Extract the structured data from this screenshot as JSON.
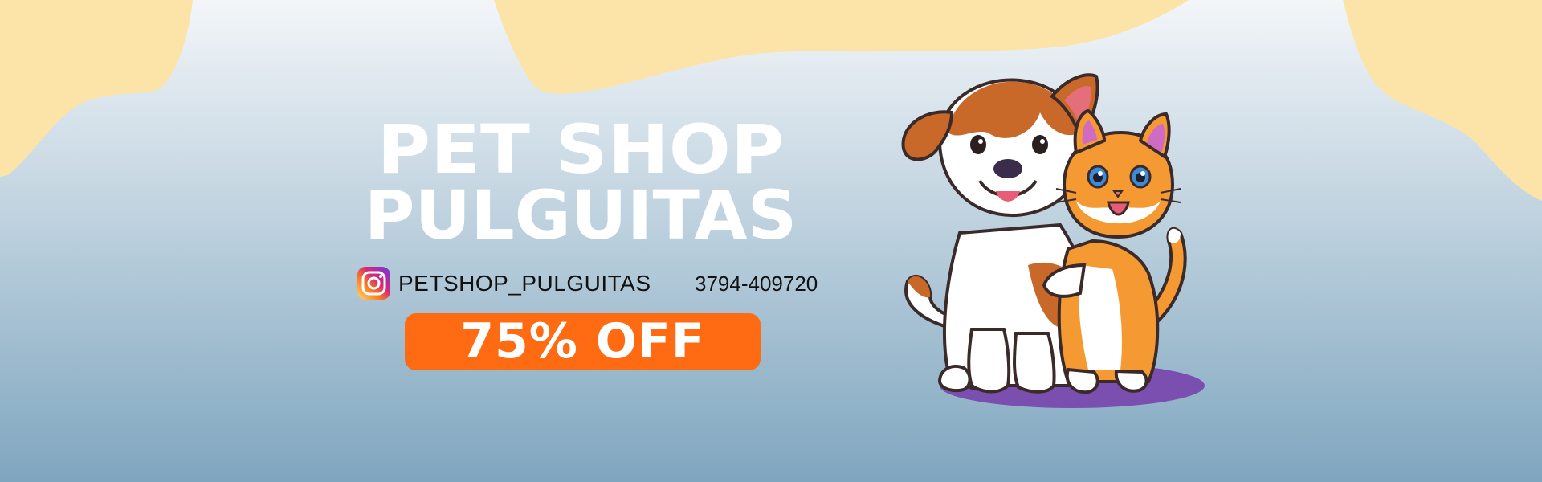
{
  "banner": {
    "title_line_1": "PET SHOP",
    "title_line_2": "PULGUITAS",
    "instagram_handle": "PETSHOP_PULGUITAS",
    "phone": "3794-409720",
    "offer": "75% OFF"
  },
  "colors": {
    "background_top": "#f3f6f9",
    "background_bottom": "#7fa6bf",
    "cream_shape": "#fce3a8",
    "offer_badge": "#ff6b12",
    "title_text": "#ffffff",
    "purple_shadow": "#7a4fb0",
    "dog_brown": "#c8692a",
    "cat_orange": "#f59a32"
  },
  "icons": {
    "instagram": "instagram-icon"
  }
}
